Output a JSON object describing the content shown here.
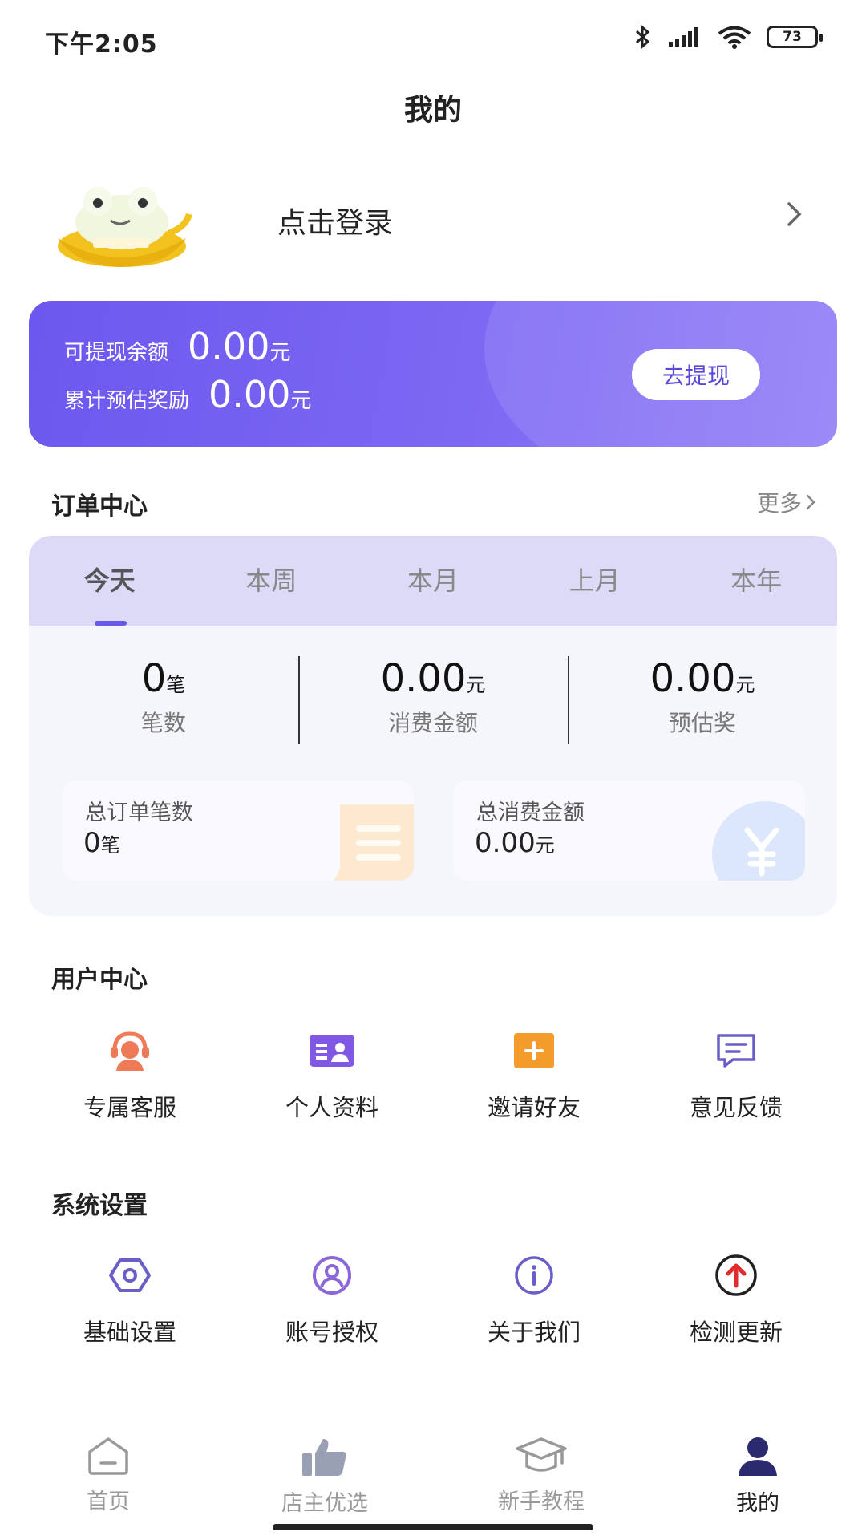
{
  "status_bar": {
    "time": "下午2:05",
    "battery": "73"
  },
  "page_title": "我的",
  "profile": {
    "login_text": "点击登录"
  },
  "wallet": {
    "balance_label": "可提现余额",
    "balance_value": "0.00",
    "balance_unit": "元",
    "reward_label": "累计预估奖励",
    "reward_value": "0.00",
    "reward_unit": "元",
    "withdraw_button": "去提现"
  },
  "order_center": {
    "title": "订单中心",
    "more": "更多",
    "tabs": [
      {
        "label": "今天",
        "active": true
      },
      {
        "label": "本周"
      },
      {
        "label": "本月"
      },
      {
        "label": "上月"
      },
      {
        "label": "本年"
      }
    ],
    "stats": [
      {
        "value": "0",
        "unit": "笔",
        "label": "笔数"
      },
      {
        "value": "0.00",
        "unit": "元",
        "label": "消费金额"
      },
      {
        "value": "0.00",
        "unit": "元",
        "label": "预估奖"
      }
    ],
    "totals": [
      {
        "label": "总订单笔数",
        "value": "0",
        "unit": "笔",
        "icon": "list-icon"
      },
      {
        "label": "总消费金额",
        "value": "0.00",
        "unit": "元",
        "icon": "yuan-coin-icon"
      }
    ]
  },
  "user_center": {
    "title": "用户中心",
    "items": [
      {
        "label": "专属客服",
        "icon": "customer-service-icon",
        "color": "#ef7a57"
      },
      {
        "label": "个人资料",
        "icon": "profile-card-icon",
        "color": "#8158e6"
      },
      {
        "label": "邀请好友",
        "icon": "invite-plus-icon",
        "color": "#f39c2b"
      },
      {
        "label": "意见反馈",
        "icon": "feedback-icon",
        "color": "#6a5fc8"
      }
    ]
  },
  "system_settings": {
    "title": "系统设置",
    "items": [
      {
        "label": "基础设置",
        "icon": "settings-icon",
        "color": "#6a5fc8"
      },
      {
        "label": "账号授权",
        "icon": "account-icon",
        "color": "#8a68d8"
      },
      {
        "label": "关于我们",
        "icon": "info-icon",
        "color": "#6a5fc8"
      },
      {
        "label": "检测更新",
        "icon": "update-arrow-icon",
        "color": "#e02c2c"
      }
    ]
  },
  "bottom_nav": [
    {
      "label": "首页",
      "icon": "home-icon"
    },
    {
      "label": "店主优选",
      "icon": "thumbs-up-icon"
    },
    {
      "label": "新手教程",
      "icon": "graduation-cap-icon"
    },
    {
      "label": "我的",
      "icon": "user-icon",
      "active": true
    }
  ]
}
